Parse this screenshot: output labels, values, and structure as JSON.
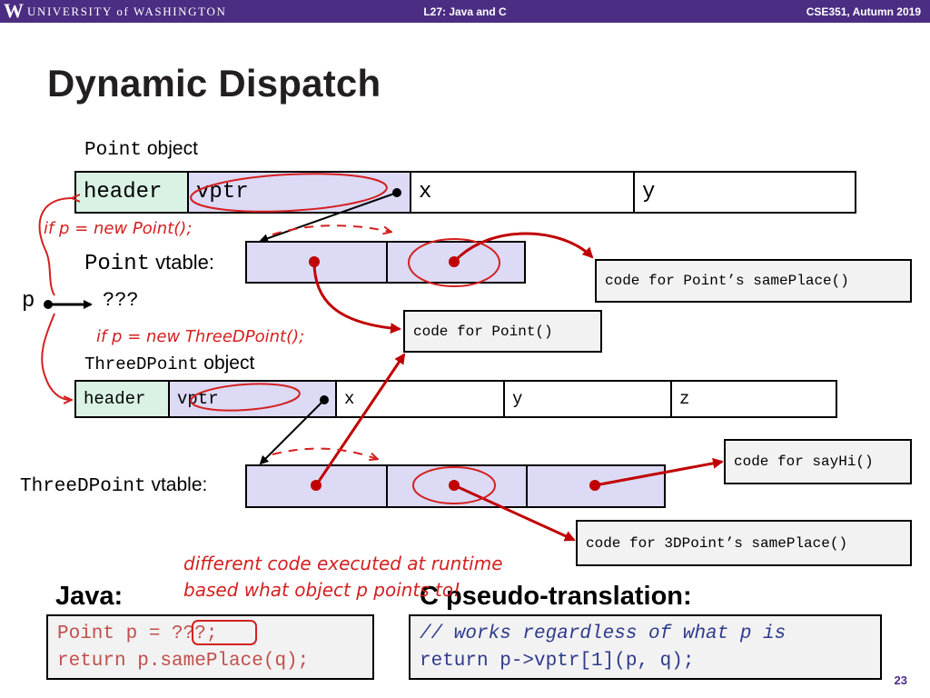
{
  "header": {
    "logo": "W",
    "university": "UNIVERSITY of WASHINGTON",
    "lecture": "L27: Java and C",
    "course": "CSE351, Autumn 2019"
  },
  "title": "Dynamic Dispatch",
  "point_object": {
    "label_code": "Point",
    "label_text": "object",
    "cells": [
      "header",
      "vptr",
      "x",
      "y"
    ]
  },
  "point_vtable": {
    "label_code": "Point",
    "label_text": "vtable:"
  },
  "pointer": {
    "name": "p",
    "target": "???"
  },
  "threed_object": {
    "label_code": "ThreeDPoint",
    "label_text": "object",
    "cells": [
      "header",
      "vptr",
      "x",
      "y",
      "z"
    ]
  },
  "threed_vtable": {
    "label_code": "ThreeDPoint",
    "label_text": "vtable:"
  },
  "code_boxes": {
    "point_sameplace": "code for Point’s samePlace()",
    "point_ctor": "code for Point()",
    "sayhi": "code for sayHi()",
    "threed_sameplace": "code for 3DPoint’s samePlace()"
  },
  "annotations": {
    "if_point": "if p = new Point();",
    "if_threed": "if p = new ThreeDPoint();",
    "runtime_1": "different code executed at runtime",
    "runtime_2": "based what object p points to!"
  },
  "java": {
    "heading": "Java:",
    "line1": "Point p = ???;",
    "line2": "return p.samePlace(q);"
  },
  "c": {
    "heading": "C pseudo-translation:",
    "line1": "// works regardless of what p is",
    "line2": "return p->vptr[1](p, q);"
  },
  "page_number": "23",
  "colors": {
    "uw_purple": "#4b2e83",
    "ink_red": "#d42020",
    "header_green": "#d9f2e4",
    "vptr_lavender": "#dcdaf5"
  }
}
